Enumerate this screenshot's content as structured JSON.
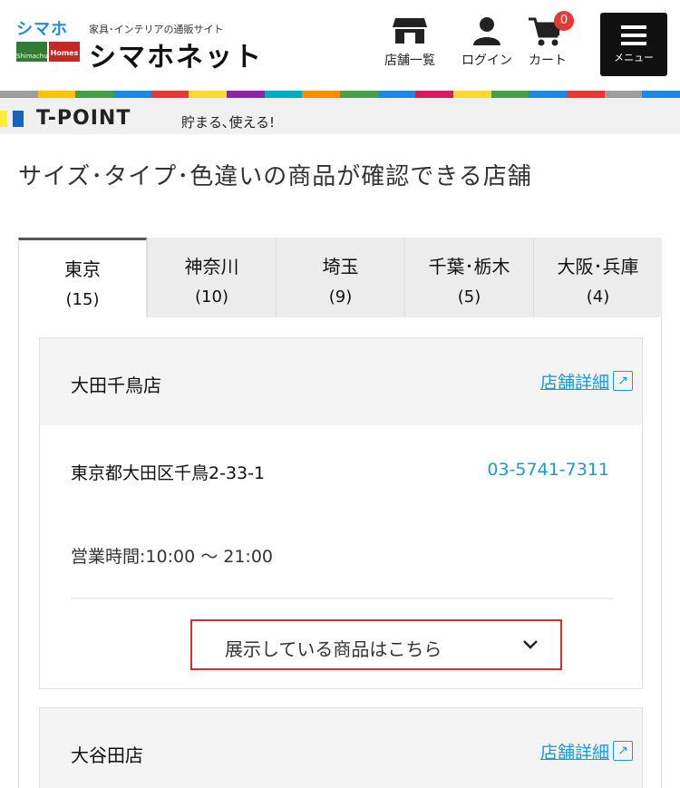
{
  "header": {
    "logo": {
      "mark_top": "シマホ",
      "mark_left": "Shimachu",
      "mark_right": "Homes",
      "tagline": "家具･インテリアの通販サイト",
      "name": "シマホネット"
    },
    "nav": {
      "stores_label": "店舗一覧",
      "login_label": "ログイン",
      "cart_label": "カート",
      "cart_count": "0",
      "menu_label": "メニュー"
    }
  },
  "strip_colors": [
    "#9e9e9e",
    "#ffc107",
    "#43a047",
    "#1e88e5",
    "#e53935",
    "#fdd835",
    "#8e24aa",
    "#00acc1",
    "#fb8c00",
    "#43a047",
    "#1e88e5",
    "#d81b60",
    "#fdd835",
    "#43a047",
    "#1e88e5",
    "#e53935",
    "#9e9e9e",
    "#1e88e5"
  ],
  "tpoint": {
    "name": "T-POINT",
    "tagline": "貯まる､使える!"
  },
  "page_title": "サイズ･タイプ･色違いの商品が確認できる店舗",
  "tabs": [
    {
      "label": "東京",
      "count": "(15)",
      "active": true
    },
    {
      "label": "神奈川",
      "count": "(10)",
      "active": false
    },
    {
      "label": "埼玉",
      "count": "(9)",
      "active": false
    },
    {
      "label": "千葉･栃木",
      "count": "(5)",
      "active": false
    },
    {
      "label": "大阪･兵庫",
      "count": "(4)",
      "active": false
    }
  ],
  "stores": [
    {
      "name": "大田千鳥店",
      "detail_link": "店舗詳細",
      "address": "東京都大田区千鳥2-33-1",
      "tel": "03-5741-7311",
      "hours": "営業時間:10:00 ～ 21:00",
      "exhibit_button": "展示している商品はこちら"
    },
    {
      "name": "大谷田店",
      "detail_link": "店舗詳細"
    }
  ],
  "colors": {
    "link": "#1a9ad6",
    "highlight": "#d32f2f",
    "tab_bg": "#ececec"
  }
}
